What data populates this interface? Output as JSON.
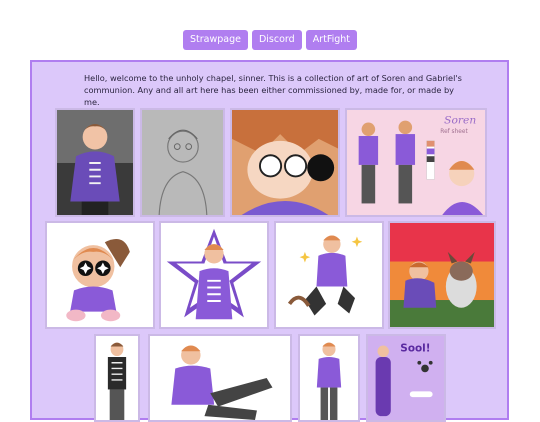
{
  "nav": {
    "items": [
      {
        "label": "Strawpage"
      },
      {
        "label": "Discord"
      },
      {
        "label": "ArtFight"
      }
    ]
  },
  "intro": {
    "text": "Hello, welcome to the unholy chapel, sinner. This is a collection of art of Soren and Gabriel's communion. Any and all art here has been either commissioned by, made for, or made by me."
  },
  "colors": {
    "accent": "#b07ef0",
    "panel": "#dcc8fa",
    "hoodie": "#8a5ad8",
    "hair": "#d9905a"
  },
  "gallery": {
    "sheet_title": "Soren",
    "sheet_subtitle": "Ref sheet",
    "sticker_text": "Sool!"
  }
}
